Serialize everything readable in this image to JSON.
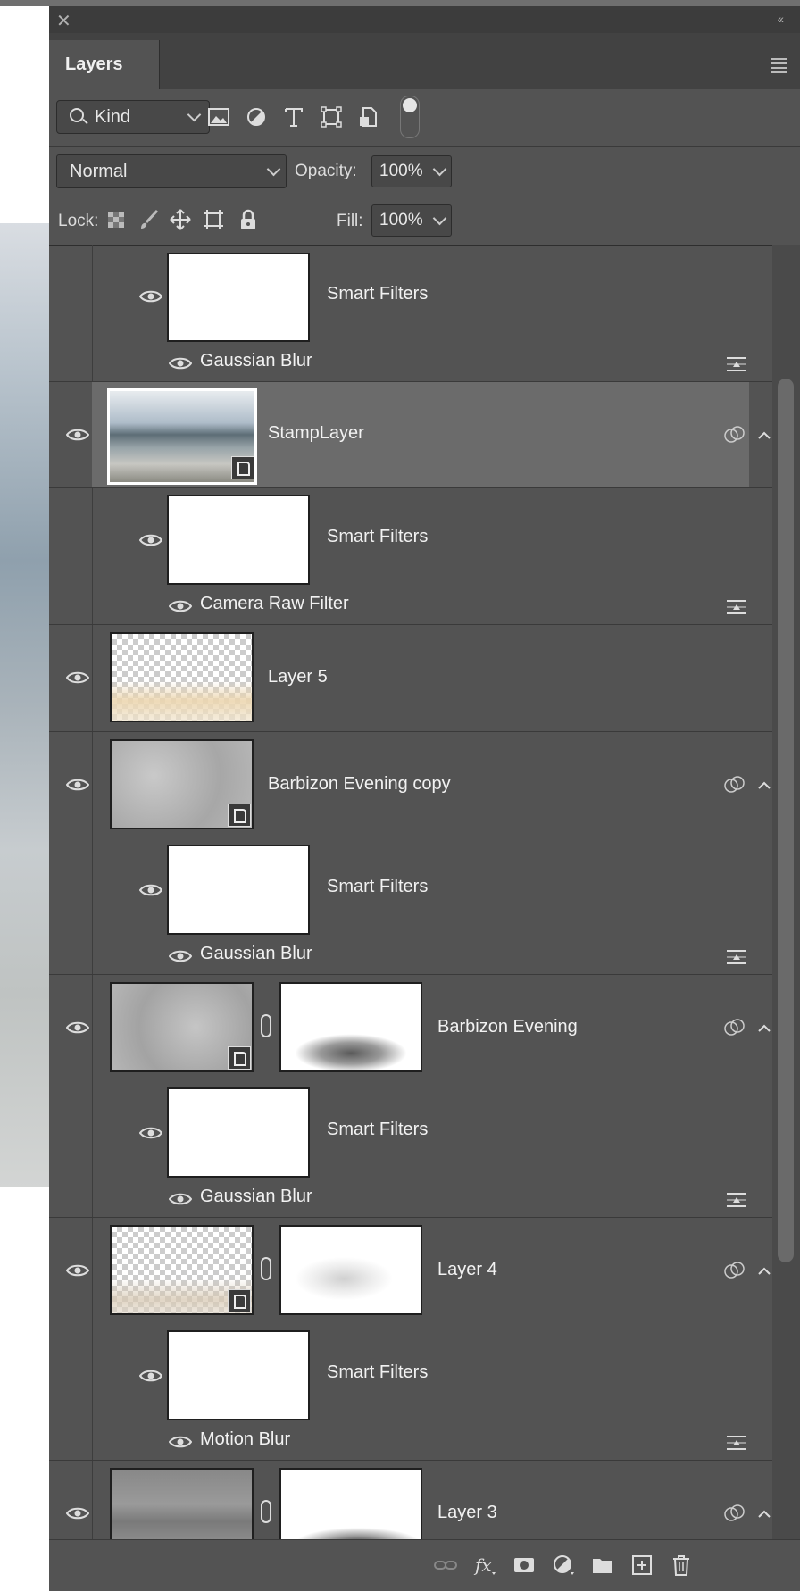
{
  "panel": {
    "title": "Layers",
    "close_glyph": "✕",
    "collapse_glyph": "‹‹"
  },
  "filter": {
    "kind_label": "Kind",
    "icons": [
      "image-filter-icon",
      "adjustment-filter-icon",
      "type-filter-icon",
      "shape-filter-icon",
      "smart-object-filter-icon"
    ]
  },
  "blend": {
    "mode": "Normal",
    "opacity_label": "Opacity:",
    "opacity_value": "100%"
  },
  "lock": {
    "label": "Lock:",
    "fill_label": "Fill:",
    "fill_value": "100%"
  },
  "layers": {
    "top_smart_filters": "Smart Filters",
    "top_filter": "Gaussian Blur",
    "stamp": "StampLayer",
    "stamp_smart_filters": "Smart Filters",
    "stamp_filter": "Camera Raw Filter",
    "layer5": "Layer 5",
    "barbizon_copy": "Barbizon Evening copy",
    "barbizon_copy_smart_filters": "Smart Filters",
    "barbizon_copy_filter": "Gaussian Blur",
    "barbizon": "Barbizon Evening",
    "barbizon_smart_filters": "Smart Filters",
    "barbizon_filter": "Gaussian Blur",
    "layer4": "Layer 4",
    "layer4_smart_filters": "Smart Filters",
    "layer4_filter": "Motion Blur",
    "layer3": "Layer 3"
  },
  "footer": {
    "icons": [
      "link-layers-icon",
      "fx-icon",
      "mask-icon",
      "adjustment-layer-icon",
      "folder-icon",
      "new-layer-icon",
      "trash-icon"
    ]
  }
}
